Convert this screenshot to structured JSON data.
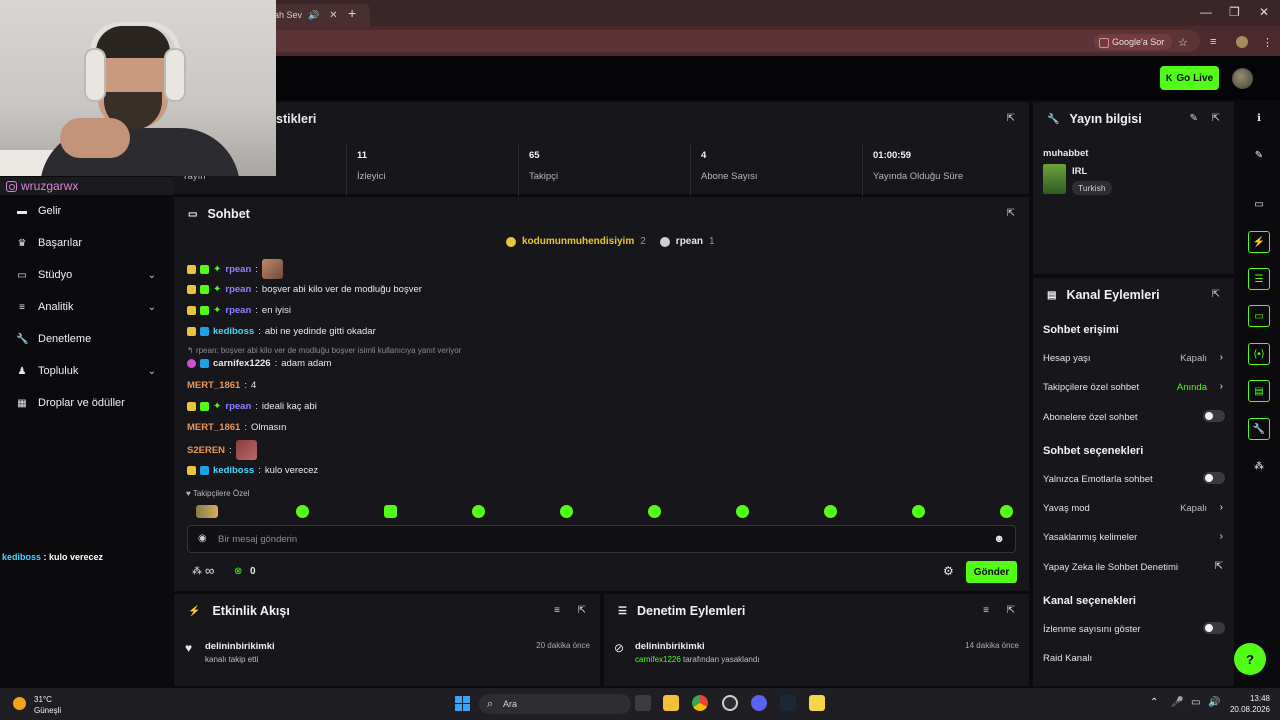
{
  "browser": {
    "tab_title": "ah Sev",
    "google_button": "Google'a Sor"
  },
  "streamer_tag": "wruzgarwx",
  "topbar": {
    "go_live": "Go Live"
  },
  "sidebar": {
    "items": [
      {
        "label": "Gelir",
        "icon": "money-icon"
      },
      {
        "label": "Başarılar",
        "icon": "trophy-icon"
      },
      {
        "label": "Stüdyo",
        "icon": "studio-icon",
        "expandable": true
      },
      {
        "label": "Analitik",
        "icon": "chart-icon",
        "expandable": true
      },
      {
        "label": "Denetleme",
        "icon": "wrench-icon"
      },
      {
        "label": "Topluluk",
        "icon": "community-icon",
        "expandable": true
      },
      {
        "label": "Droplar ve ödüller",
        "icon": "gift-icon"
      }
    ]
  },
  "overlay_chat": {
    "user": "kediboss",
    "text": " : kulo verecez"
  },
  "stats": {
    "title": "stikleri",
    "cells": [
      {
        "value": "",
        "label": "Yayın"
      },
      {
        "value": "11",
        "label": "İzleyici"
      },
      {
        "value": "65",
        "label": "Takipçi"
      },
      {
        "value": "4",
        "label": "Abone Sayısı"
      },
      {
        "value": "01:00:59",
        "label": "Yayında Olduğu Süre"
      }
    ]
  },
  "chat": {
    "title": "Sohbet",
    "pinned": [
      {
        "user": "kodumunmuhendisiyim",
        "count": "2"
      },
      {
        "user": "rpean",
        "count": "1"
      }
    ],
    "messages": [
      {
        "user": "rpean",
        "text": "",
        "color": "#8f83ff"
      },
      {
        "user": "rpean",
        "text": "boşver abi kilo ver de modluğu boşver",
        "color": "#8f83ff"
      },
      {
        "user": "rpean",
        "text": "en iyisi",
        "color": "#8f83ff"
      },
      {
        "user": "kediboss",
        "text": "abi ne yedinde gitti okadar",
        "color": "#49d5ff"
      },
      {
        "user": "carnifex1226",
        "text": "adam adam",
        "color": "#e9e9ec"
      },
      {
        "user": "MERT_1861",
        "text": "4",
        "color": "#e8965a"
      },
      {
        "user": "rpean",
        "text": "ideali kaç abi",
        "color": "#8f83ff"
      },
      {
        "user": "MERT_1861",
        "text": "Olmasın",
        "color": "#e8965a"
      },
      {
        "user": "S2EREN",
        "text": "",
        "color": "#e8965a"
      },
      {
        "user": "kediboss",
        "text": "kulo verecez",
        "color": "#49d5ff"
      }
    ],
    "reply_note": "rpean: boşver abi kilo ver de modluğu boşver isimli kullanıcıya yanıt veriyor",
    "followers_only": "Takipçilere Özel",
    "input_placeholder": "Bir mesaj gönderin",
    "infinity": "∞",
    "points": "0",
    "send": "Gönder"
  },
  "activity": {
    "title": "Etkinlik Akışı",
    "items": [
      {
        "name": "delininbirikimki",
        "sub": "kanalı takip etti",
        "time": "20 dakika önce"
      }
    ]
  },
  "moderation": {
    "title": "Denetim Eylemleri",
    "items": [
      {
        "name": "delininbirikimki",
        "sub_user": "carnifex1226",
        "sub": " tarafından yasaklandı",
        "time": "14 dakika önce"
      }
    ]
  },
  "stream_info": {
    "title": "Yayın bilgisi",
    "stream_title": "muhabbet",
    "category": "IRL",
    "language": "Turkish"
  },
  "channel_actions": {
    "title": "Kanal Eylemleri",
    "chat_access": "Sohbet erişimi",
    "account_age": {
      "label": "Hesap yaşı",
      "value": "Kapalı"
    },
    "followers_chat": {
      "label": "Takipçilere özel sohbet",
      "value": "Anında"
    },
    "subscribers_chat": {
      "label": "Abonelere özel sohbet"
    },
    "chat_options": "Sohbet seçenekleri",
    "emote_only": {
      "label": "Yalnızca Emotlarla sohbet"
    },
    "slow_mode": {
      "label": "Yavaş mod",
      "value": "Kapalı"
    },
    "banned_words": {
      "label": "Yasaklanmış kelimeler"
    },
    "ai_moderation": {
      "label": "Yapay Zeka ile Sohbet Denetimi"
    },
    "channel_options": "Kanal seçenekleri",
    "show_viewers": {
      "label": "İzlenme sayısını göster"
    },
    "raid": {
      "label": "Raid Kanalı"
    }
  },
  "taskbar": {
    "temp": "31°C",
    "weather": "Güneşli",
    "search": "Ara",
    "time": "13:48",
    "date": "20.08.2026"
  },
  "colors": {
    "accent": "#53fc18",
    "panel": "#17171b",
    "bg": "#0b0b0e"
  }
}
